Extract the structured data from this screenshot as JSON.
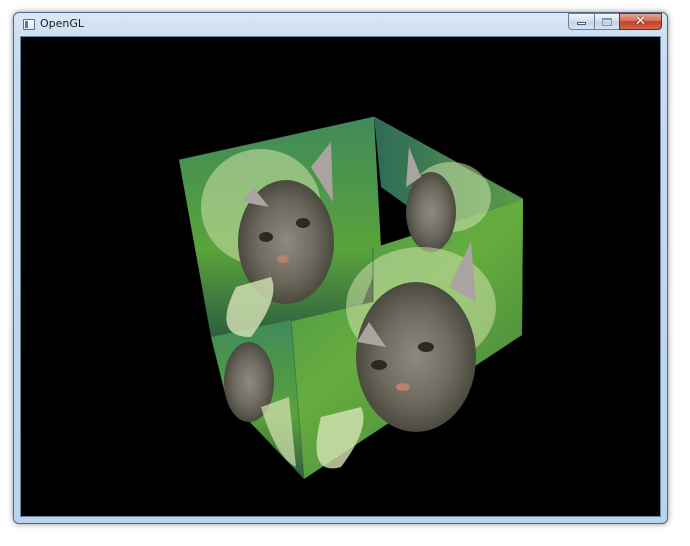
{
  "window": {
    "title": "OpenGL",
    "controls": {
      "minimize_icon": "minimize-icon",
      "maximize_icon": "maximize-icon",
      "close_glyph": "✕"
    }
  },
  "viewport": {
    "background": "#000000",
    "scene": "textured-cube",
    "texture": "kitten-on-green"
  },
  "colors": {
    "titlebar": "#c9dcf0",
    "close_button": "#c2412a",
    "viewport": "#000000"
  }
}
